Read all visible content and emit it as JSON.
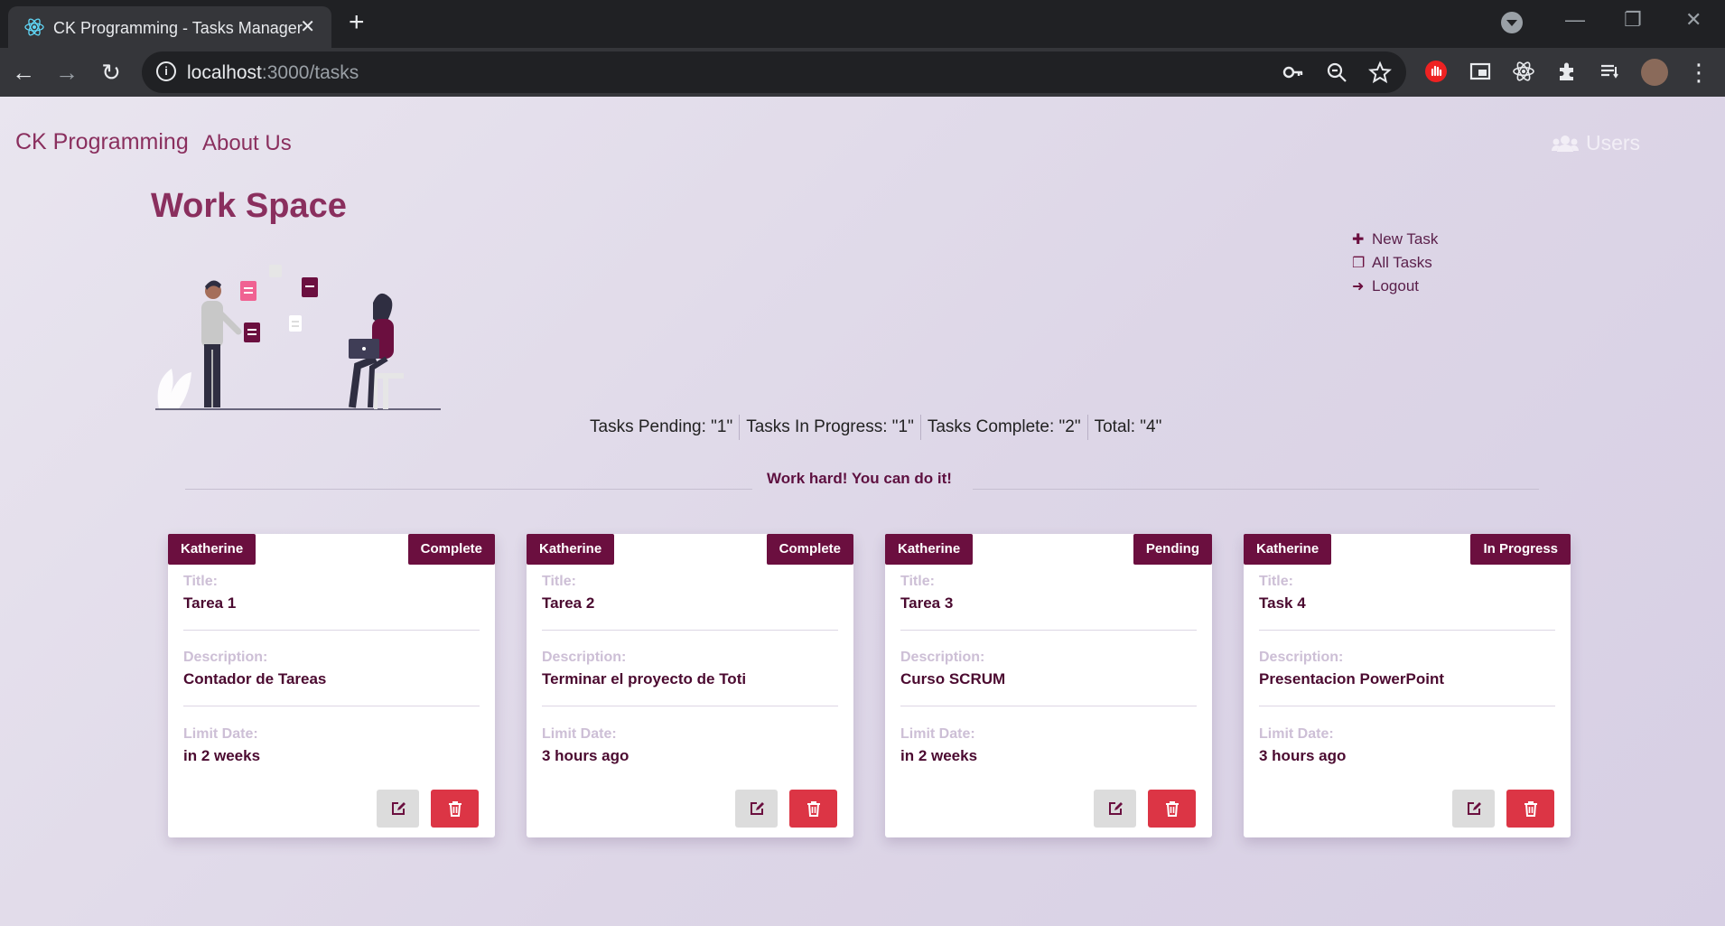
{
  "browser": {
    "tab_title": "CK Programming - Tasks Manager",
    "url_host": "localhost",
    "url_path": ":3000/tasks"
  },
  "nav": {
    "brand": "CK Programming",
    "about": "About Us",
    "users": "Users"
  },
  "workspace": {
    "title": "Work Space"
  },
  "side_menu": [
    {
      "icon": "plus-icon",
      "label": "New Task"
    },
    {
      "icon": "square-icon",
      "label": "All Tasks"
    },
    {
      "icon": "logout-icon",
      "label": "Logout"
    }
  ],
  "stats": {
    "pending": "Tasks Pending: \"1\"",
    "in_progress": "Tasks In Progress: \"1\"",
    "complete": "Tasks Complete: \"2\"",
    "total": "Total: \"4\""
  },
  "motto": "Work hard! You can do it!",
  "labels": {
    "title": "Title:",
    "description": "Description:",
    "limit_date": "Limit Date:"
  },
  "tasks": [
    {
      "owner": "Katherine",
      "status": "Complete",
      "title": "Tarea 1",
      "description": "Contador de Tareas",
      "limit_date": "in 2 weeks"
    },
    {
      "owner": "Katherine",
      "status": "Complete",
      "title": "Tarea 2",
      "description": "Terminar el proyecto de Toti",
      "limit_date": "3 hours ago"
    },
    {
      "owner": "Katherine",
      "status": "Pending",
      "title": "Tarea 3",
      "description": "Curso SCRUM",
      "limit_date": "in 2 weeks"
    },
    {
      "owner": "Katherine",
      "status": "In Progress",
      "title": "Task 4",
      "description": "Presentacion PowerPoint",
      "limit_date": "3 hours ago"
    }
  ],
  "colors": {
    "accent": "#6b0f3f",
    "brand_text": "#8a2f5e",
    "danger": "#dc3545",
    "page_bg": "#e4deec"
  }
}
